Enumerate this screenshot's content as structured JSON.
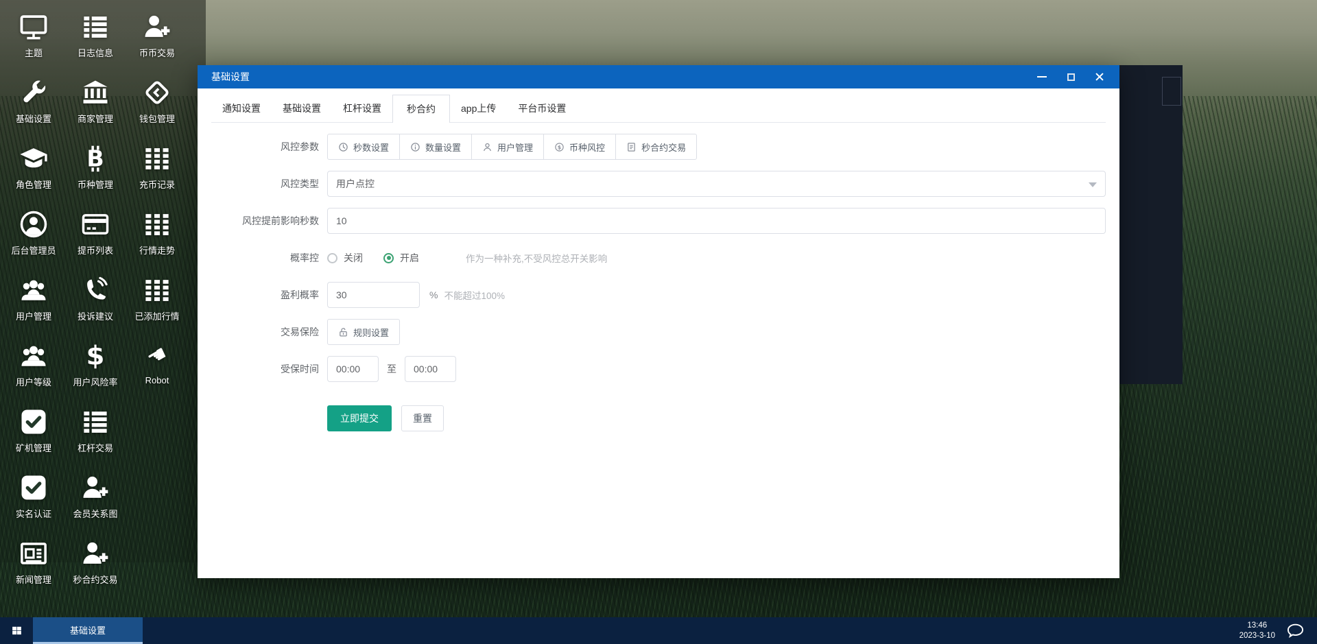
{
  "desktop": {
    "icons": [
      {
        "label": "主题",
        "icon": "monitor-icon"
      },
      {
        "label": "日志信息",
        "icon": "log-list-icon"
      },
      {
        "label": "币币交易",
        "icon": "user-plus-icon"
      },
      {
        "label": "基础设置",
        "icon": "wrench-icon"
      },
      {
        "label": "商家管理",
        "icon": "bank-icon"
      },
      {
        "label": "钱包管理",
        "icon": "wallet-icon"
      },
      {
        "label": "角色管理",
        "icon": "graduation-cap-icon"
      },
      {
        "label": "币种管理",
        "icon": "bitcoin-icon"
      },
      {
        "label": "充币记录",
        "icon": "grid-icon"
      },
      {
        "label": "后台管理员",
        "icon": "user-circle-icon"
      },
      {
        "label": "提币列表",
        "icon": "card-icon"
      },
      {
        "label": "行情走势",
        "icon": "grid-icon"
      },
      {
        "label": "用户管理",
        "icon": "users-icon"
      },
      {
        "label": "投诉建议",
        "icon": "phone-icon"
      },
      {
        "label": "已添加行情",
        "icon": "grid-icon"
      },
      {
        "label": "用户等级",
        "icon": "users-icon"
      },
      {
        "label": "用户风险率",
        "icon": "dollar-icon"
      },
      {
        "label": "Robot",
        "icon": "hand-icon"
      },
      {
        "label": "矿机管理",
        "icon": "check-square-icon"
      },
      {
        "label": "杠杆交易",
        "icon": "log-list-icon"
      },
      {
        "label": "实名认证",
        "icon": "check-square-icon"
      },
      {
        "label": "会员关系图",
        "icon": "user-plus-icon"
      },
      {
        "label": "新闻管理",
        "icon": "news-icon"
      },
      {
        "label": "秒合约交易",
        "icon": "user-plus-icon"
      }
    ]
  },
  "window": {
    "title": "基础设置",
    "controls": {
      "minimize": "minimize-icon",
      "maximize": "maximize-icon",
      "close": "close-icon"
    },
    "tabs": [
      {
        "label": "通知设置",
        "active": false
      },
      {
        "label": "基础设置",
        "active": false
      },
      {
        "label": "杠杆设置",
        "active": false
      },
      {
        "label": "秒合约",
        "active": true
      },
      {
        "label": "app上传",
        "active": false
      },
      {
        "label": "平台币设置",
        "active": false
      }
    ],
    "form": {
      "risk_params_label": "风控参数",
      "risk_buttons": [
        {
          "label": "秒数设置",
          "icon": "clock-icon"
        },
        {
          "label": "数量设置",
          "icon": "info-icon"
        },
        {
          "label": "用户管理",
          "icon": "user-icon"
        },
        {
          "label": "币种风控",
          "icon": "dollar-circle-icon"
        },
        {
          "label": "秒合约交易",
          "icon": "document-icon"
        }
      ],
      "risk_type_label": "风控类型",
      "risk_type_value": "用户点控",
      "advance_seconds_label": "风控提前影响秒数",
      "advance_seconds_value": "10",
      "probability_label": "概率控",
      "radio_off_label": "关闭",
      "radio_on_label": "开启",
      "radio_checked": "开启",
      "probability_hint": "作为一种补充,不受风控总开关影响",
      "profit_label": "盈利概率",
      "profit_value": "30",
      "profit_suffix": "%",
      "profit_hint": "不能超过100%",
      "insurance_label": "交易保险",
      "insurance_button_label": "规则设置",
      "insured_time_label": "受保时间",
      "time_from_value": "00:00",
      "time_separator": "至",
      "time_to_value": "00:00",
      "submit_label": "立即提交",
      "reset_label": "重置"
    }
  },
  "taskbar": {
    "item_label": "基础设置",
    "time": "13:46",
    "date": "2023-3-10"
  },
  "colors": {
    "titlebar_blue": "#0c64be",
    "accent_teal": "#14a186",
    "radio_green": "#3ba272",
    "taskbar_bg": "#0b2140",
    "taskbar_item_bg": "#1b4f87",
    "taskbar_item_underline": "#a9c7e8",
    "border_gray": "#dcdfe6"
  }
}
